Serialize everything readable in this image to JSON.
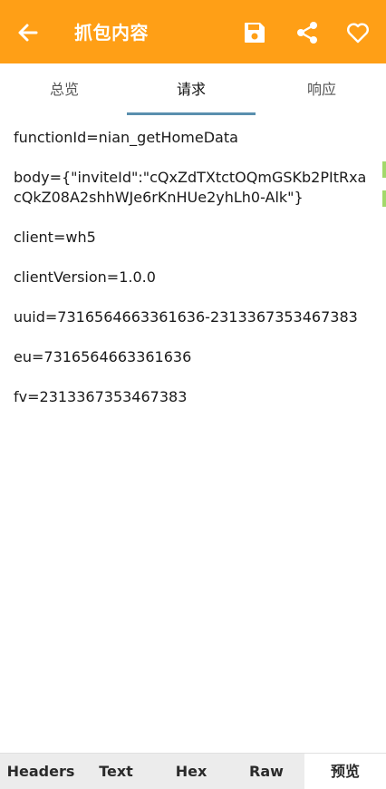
{
  "colors": {
    "appbar": "#ff9f16",
    "indicator": "#5a8fae",
    "bottombar": "#ececec"
  },
  "header": {
    "title": "抓包内容",
    "icons": [
      "arrow-left-icon",
      "save-icon",
      "share-icon",
      "heart-icon"
    ]
  },
  "tabs": [
    {
      "label": "总览"
    },
    {
      "label": "请求",
      "active": true
    },
    {
      "label": "响应"
    }
  ],
  "request": {
    "lines": [
      "functionId=nian_getHomeData",
      "body={\"inviteId\":\"cQxZdTXtctOQmGSKb2PItRxacQkZ08A2shhWJe6rKnHUe2yhLh0-Alk\"}",
      "client=wh5",
      "clientVersion=1.0.0",
      "uuid=7316564663361636-2313367353467383",
      "eu=7316564663361636",
      "fv=2313367353467383"
    ]
  },
  "bottom_tabs": [
    {
      "label": "Headers"
    },
    {
      "label": "Text"
    },
    {
      "label": "Hex"
    },
    {
      "label": "Raw"
    },
    {
      "label": "预览",
      "active": true
    }
  ]
}
